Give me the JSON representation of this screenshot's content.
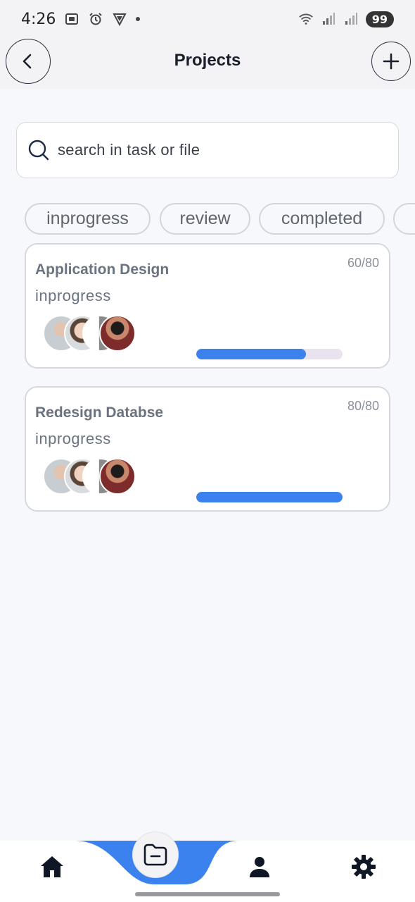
{
  "status_bar": {
    "time": "4:26",
    "battery": "99",
    "icons": [
      "screenshot-icon",
      "alarm-icon",
      "vpn-icon",
      "dot-icon",
      "wifi-icon",
      "signal-icon",
      "signal-icon"
    ]
  },
  "header": {
    "title": "Projects",
    "back_icon": "chevron-left-icon",
    "add_icon": "plus-icon"
  },
  "search": {
    "placeholder": "search in task or file",
    "icon": "search-icon"
  },
  "filters": [
    "inprogress",
    "review",
    "completed"
  ],
  "projects": [
    {
      "title": "Application Design",
      "status": "inprogress",
      "count": "60/80",
      "progress": 0.75
    },
    {
      "title": "Redesign Databse",
      "status": "inprogress",
      "count": "80/80",
      "progress": 1.0
    }
  ],
  "bottom_nav": {
    "items": [
      "home-icon",
      "folder-icon",
      "person-icon",
      "gear-icon"
    ],
    "active": "folder-icon"
  },
  "colors": {
    "accent": "#3b82ee",
    "background": "#f7f8fb",
    "text_dark": "#1b1f2c",
    "text_muted": "#6b7380",
    "progress_track": "#e8e3ee"
  }
}
